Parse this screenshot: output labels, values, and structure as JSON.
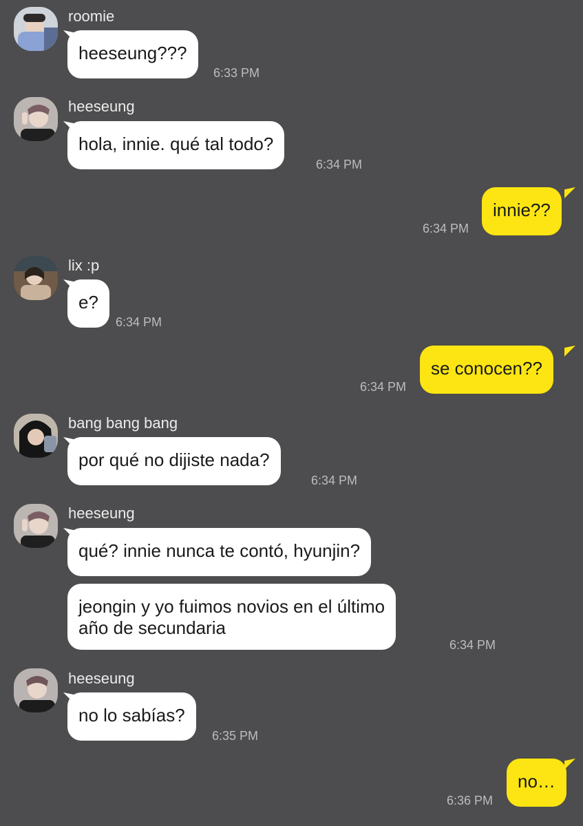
{
  "messages": [
    {
      "sender": "roomie",
      "text": "heeseung???",
      "time": "6:33 PM"
    },
    {
      "sender": "heeseung",
      "text": "hola, innie. qué tal todo?",
      "time": "6:34 PM"
    },
    {
      "sender": "me",
      "text": "innie??",
      "time": "6:34 PM"
    },
    {
      "sender": "lix :p",
      "text": "e?",
      "time": "6:34 PM"
    },
    {
      "sender": "me",
      "text": "se conocen??",
      "time": "6:34 PM"
    },
    {
      "sender": "bang bang bang",
      "text": "por qué no dijiste nada?",
      "time": "6:34 PM"
    },
    {
      "sender": "heeseung",
      "text": "qué? innie nunca te contó, hyunjin?",
      "time": ""
    },
    {
      "sender": "heeseung",
      "text": "jeongin y yo fuimos novios en el último\naño de secundaria",
      "time": "6:34 PM"
    },
    {
      "sender": "heeseung",
      "text": "no lo sabías?",
      "time": "6:35 PM"
    },
    {
      "sender": "me",
      "text": "no…",
      "time": "6:36 PM"
    }
  ],
  "colors": {
    "background": "#4d4c4e",
    "incoming_bubble": "#ffffff",
    "outgoing_bubble": "#fce512",
    "name_text": "#ececec",
    "time_text": "#bdbdbd"
  }
}
